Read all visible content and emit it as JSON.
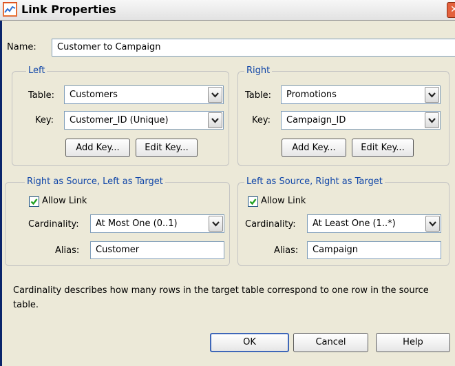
{
  "window": {
    "title": "Link Properties",
    "close_label": "✕"
  },
  "name": {
    "label": "Name:",
    "value": "Customer to Campaign"
  },
  "left": {
    "title": "Left",
    "table_label": "Table:",
    "table_value": "Customers",
    "key_label": "Key:",
    "key_value": "Customer_ID (Unique)",
    "add_key": "Add Key...",
    "edit_key": "Edit Key..."
  },
  "right": {
    "title": "Right",
    "table_label": "Table:",
    "table_value": "Promotions",
    "key_label": "Key:",
    "key_value": "Campaign_ID",
    "add_key": "Add Key...",
    "edit_key": "Edit Key..."
  },
  "rs_lt": {
    "title": "Right as Source, Left as Target",
    "allow_link": "Allow Link",
    "allow_checked": true,
    "cardinality_label": "Cardinality:",
    "cardinality_value": "At Most One (0..1)",
    "alias_label": "Alias:",
    "alias_value": "Customer"
  },
  "ls_rt": {
    "title": "Left as Source, Right as Target",
    "allow_link": "Allow Link",
    "allow_checked": true,
    "cardinality_label": "Cardinality:",
    "cardinality_value": "At Least One (1..*)",
    "alias_label": "Alias:",
    "alias_value": "Campaign"
  },
  "description": "Cardinality describes how many rows in the target table correspond to one row in the source table.",
  "buttons": {
    "ok": "OK",
    "cancel": "Cancel",
    "help": "Help"
  },
  "colors": {
    "group_title": "#1046a8",
    "dialog_bg": "#ece9d8",
    "field_border": "#7f9db9"
  }
}
